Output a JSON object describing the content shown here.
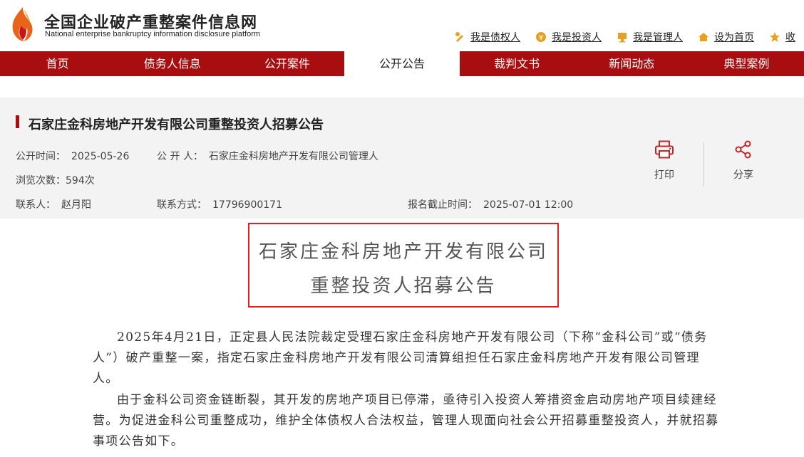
{
  "site": {
    "title": "全国企业破产重整案件信息网",
    "subtitle": "National enterprise bankruptcy  information disclosure platform"
  },
  "toplinks": [
    {
      "label": "我是债权人",
      "icon": "creditor-icon"
    },
    {
      "label": "我是投资人",
      "icon": "investor-icon"
    },
    {
      "label": "我是管理人",
      "icon": "manager-icon"
    },
    {
      "label": "设为首页",
      "icon": "home-icon"
    },
    {
      "label": "收",
      "icon": "star-icon"
    }
  ],
  "nav": [
    {
      "label": "首页",
      "active": false
    },
    {
      "label": "债务人信息",
      "active": false
    },
    {
      "label": "公开案件",
      "active": false
    },
    {
      "label": "公开公告",
      "active": true
    },
    {
      "label": "裁判文书",
      "active": false
    },
    {
      "label": "新闻动态",
      "active": false
    },
    {
      "label": "典型案例",
      "active": false
    }
  ],
  "notice": {
    "title": "石家庄金科房地产开发有限公司重整投资人招募公告",
    "publish_time_label": "公开时间：",
    "publish_time": "2025-05-26",
    "publisher_label": "公 开 人：",
    "publisher": "石家庄金科房地产开发有限公司管理人",
    "views_label": "浏览次数：",
    "views": "594次",
    "contact_label": "联系人：",
    "contact": "赵月阳",
    "phone_label": "联系方式：",
    "phone": "17796900171",
    "deadline_label": "报名截止时间：",
    "deadline": "2025-07-01 12:00",
    "print_label": "打印",
    "share_label": "分享"
  },
  "document": {
    "headline_line1": "石家庄金科房地产开发有限公司",
    "headline_line2": "重整投资人招募公告",
    "paragraphs": [
      "2025年4月21日，正定县人民法院裁定受理石家庄金科房地产开发有限公司（下称“金科公司”或“债务人”）破产重整一案，指定石家庄金科房地产开发有限公司清算组担任石家庄金科房地产开发有限公司管理人。",
      "由于金科公司资金链断裂，其开发的房地产项目已停滞，亟待引入投资人筹措资金启动房地产项目续建经营。为促进金科公司重整成功，维护全体债权人合法权益，管理人现面向社会公开招募重整投资人，并就招募事项公告如下。"
    ]
  },
  "colors": {
    "brand_red": "#a80d10",
    "highlight_border": "#e02020",
    "panel_gray": "#f3f3f3"
  }
}
